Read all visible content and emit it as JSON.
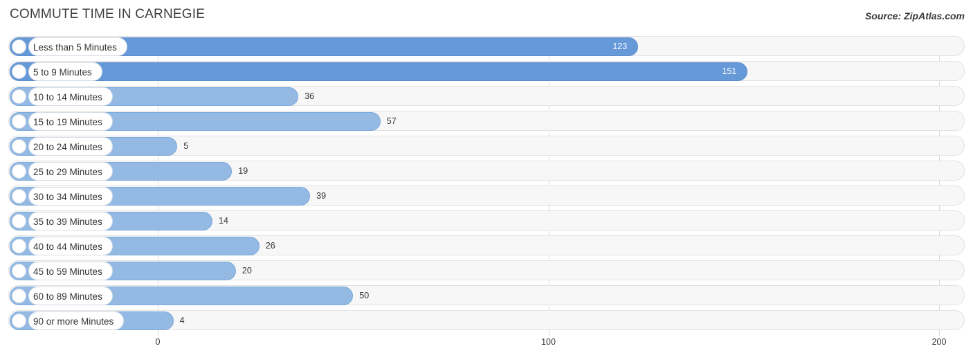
{
  "header": {
    "title": "COMMUTE TIME IN CARNEGIE",
    "source": "Source: ZipAtlas.com"
  },
  "chart_data": {
    "type": "bar",
    "orientation": "horizontal",
    "title": "COMMUTE TIME IN CARNEGIE",
    "xlabel": "",
    "ylabel": "",
    "xlim": [
      0,
      200
    ],
    "xticks": [
      0,
      100,
      200
    ],
    "xtick_labels": [
      "0",
      "100",
      "200"
    ],
    "grid": true,
    "legend": null,
    "categories": [
      "Less than 5 Minutes",
      "5 to 9 Minutes",
      "10 to 14 Minutes",
      "15 to 19 Minutes",
      "20 to 24 Minutes",
      "25 to 29 Minutes",
      "30 to 34 Minutes",
      "35 to 39 Minutes",
      "40 to 44 Minutes",
      "45 to 59 Minutes",
      "60 to 89 Minutes",
      "90 or more Minutes"
    ],
    "values": [
      123,
      151,
      36,
      57,
      5,
      19,
      39,
      14,
      26,
      20,
      50,
      4
    ],
    "value_labels": [
      "123",
      "151",
      "36",
      "57",
      "5",
      "19",
      "39",
      "14",
      "26",
      "20",
      "50",
      "4"
    ],
    "colors": {
      "bar_light": "#94bae4",
      "bar_dark": "#6699d8",
      "track": "#f7f7f7",
      "grid": "#d8d8d8"
    }
  }
}
